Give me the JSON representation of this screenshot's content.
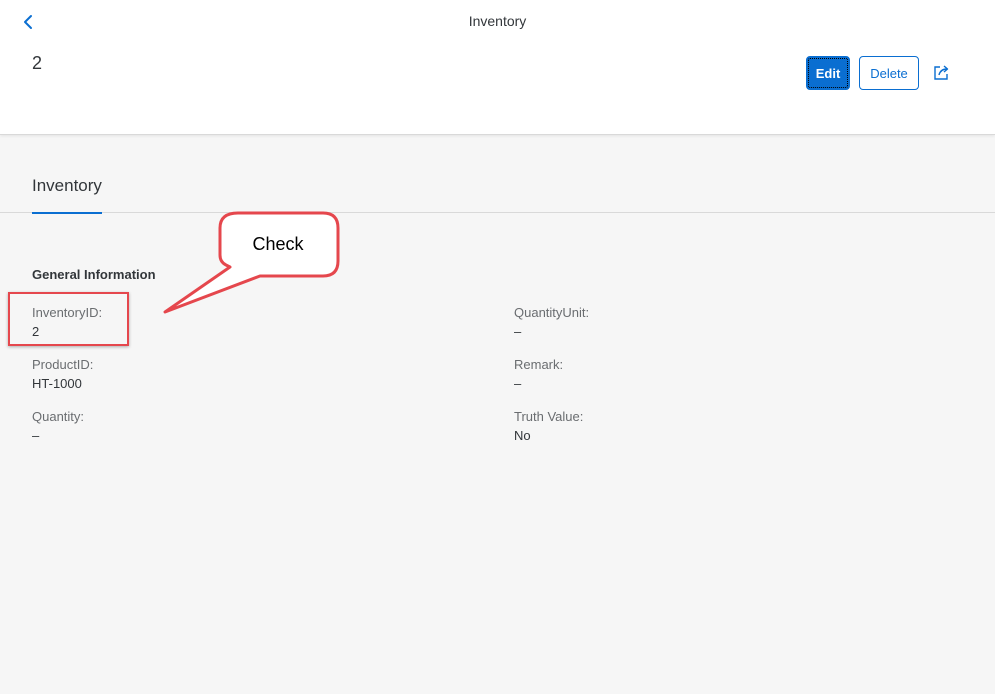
{
  "header": {
    "app_title": "Inventory",
    "object_title": "2",
    "edit_label": "Edit",
    "delete_label": "Delete"
  },
  "tabs": [
    {
      "label": "Inventory"
    }
  ],
  "section": {
    "title": "General Information",
    "fields": [
      {
        "label": "InventoryID:",
        "value": "2"
      },
      {
        "label": "ProductID:",
        "value": "HT-1000"
      },
      {
        "label": "Quantity:",
        "value": "–"
      },
      {
        "label": "QuantityUnit:",
        "value": "–"
      },
      {
        "label": "Remark:",
        "value": "–"
      },
      {
        "label": "Truth Value:",
        "value": "No"
      }
    ]
  },
  "annotation": {
    "callout_text": "Check",
    "color": "#e5474d"
  },
  "colors": {
    "accent": "#0a6ed1",
    "background": "#f6f6f6",
    "header_bg": "#ffffff"
  },
  "icons": {
    "back": "chevron-left-icon",
    "share": "share-icon"
  }
}
